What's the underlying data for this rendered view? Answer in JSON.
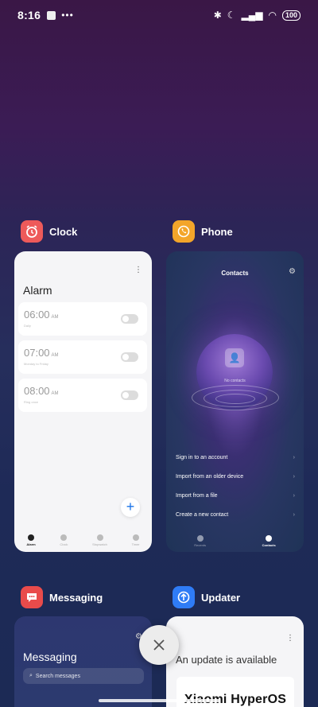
{
  "status": {
    "time": "8:16",
    "battery": "100"
  },
  "apps": {
    "clock": {
      "name": "Clock",
      "title": "Alarm",
      "alarms": [
        {
          "time": "06:00",
          "ampm": "AM",
          "sub": "Daily"
        },
        {
          "time": "07:00",
          "ampm": "AM",
          "sub": "Monday to Friday"
        },
        {
          "time": "08:00",
          "ampm": "AM",
          "sub": "Ring once"
        }
      ],
      "nav": [
        "Alarm",
        "Clock",
        "Stopwatch",
        "Timer"
      ]
    },
    "phone": {
      "name": "Phone",
      "title": "Contacts",
      "empty": "No contacts",
      "options": [
        "Sign in to an account",
        "Import from an older device",
        "Import from a file",
        "Create a new contact"
      ],
      "nav": [
        "Recents",
        "Contacts"
      ]
    },
    "messaging": {
      "name": "Messaging",
      "title": "Messaging",
      "search_placeholder": "Search messages"
    },
    "updater": {
      "name": "Updater",
      "title": "An update is available",
      "logo_text": "Xiaomi HyperOS"
    }
  },
  "colors": {
    "clock_icon": "#ee5a5a",
    "phone_icon": "#f3a52a",
    "messaging_icon": "#e94b4b",
    "updater_icon": "#2f7cf6",
    "accent_blue": "#1a73e8"
  }
}
